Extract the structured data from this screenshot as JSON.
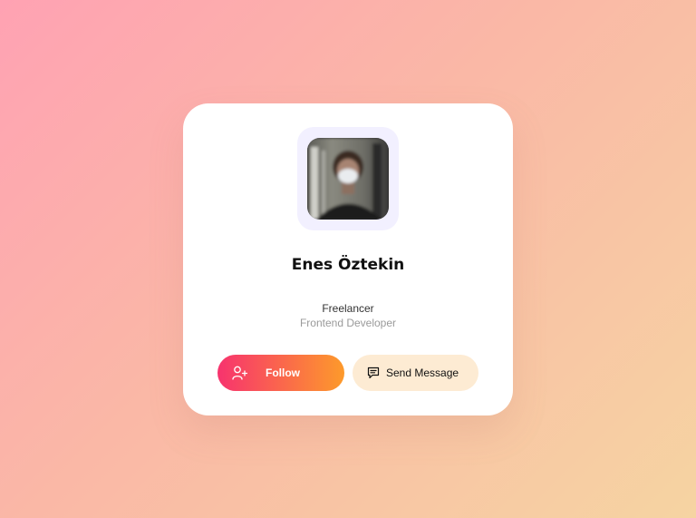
{
  "profile": {
    "name": "Enes Öztekin",
    "role": "Freelancer",
    "subrole": "Frontend Developer"
  },
  "actions": {
    "follow_label": "Follow",
    "follow_icon": "user-plus-icon",
    "message_label": "Send Message",
    "message_icon": "message-icon"
  },
  "colors": {
    "follow_gradient_start": "#f7336e",
    "follow_gradient_end": "#fd9a2b",
    "message_bg": "#fdebd3",
    "avatar_frame_bg": "#f2f0ff"
  }
}
